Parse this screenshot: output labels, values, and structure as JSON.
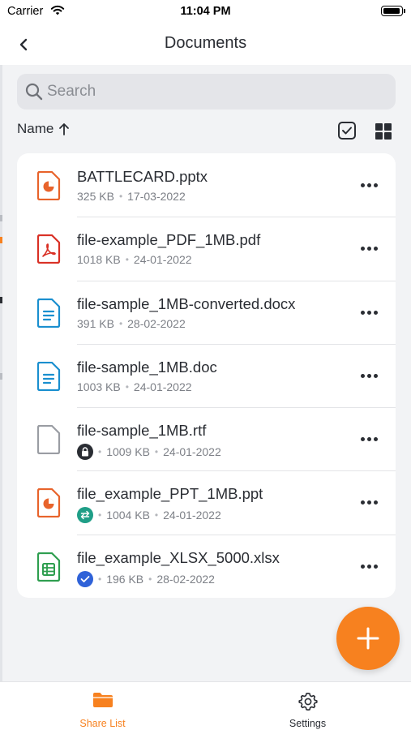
{
  "status_bar": {
    "carrier": "Carrier",
    "time": "11:04 PM"
  },
  "nav": {
    "title": "Documents"
  },
  "search": {
    "placeholder": "Search"
  },
  "sort": {
    "label": "Name",
    "direction": "ascending"
  },
  "files": [
    {
      "name": "BATTLECARD.pptx",
      "size": "325 KB",
      "date": "17-03-2022",
      "icon": "presentation-icon",
      "color": "#e8632b",
      "badge": null
    },
    {
      "name": "file-example_PDF_1MB.pdf",
      "size": "1018 KB",
      "date": "24-01-2022",
      "icon": "pdf-icon",
      "color": "#d93025",
      "badge": null
    },
    {
      "name": "file-sample_1MB-converted.docx",
      "size": "391 KB",
      "date": "28-02-2022",
      "icon": "document-icon",
      "color": "#1a8fcf",
      "badge": null
    },
    {
      "name": "file-sample_1MB.doc",
      "size": "1003 KB",
      "date": "24-01-2022",
      "icon": "document-icon",
      "color": "#1a8fcf",
      "badge": null
    },
    {
      "name": "file-sample_1MB.rtf",
      "size": "1009 KB",
      "date": "24-01-2022",
      "icon": "blank-file-icon",
      "color": "#9a9da3",
      "badge": "lock-icon"
    },
    {
      "name": "file_example_PPT_1MB.ppt",
      "size": "1004 KB",
      "date": "24-01-2022",
      "icon": "presentation-icon",
      "color": "#e8632b",
      "badge": "sync-icon"
    },
    {
      "name": "file_example_XLSX_5000.xlsx",
      "size": "196 KB",
      "date": "28-02-2022",
      "icon": "spreadsheet-icon",
      "color": "#2e9e4f",
      "badge": "check-icon"
    }
  ],
  "tabs": [
    {
      "label": "Share List",
      "icon": "folder-icon",
      "active": true
    },
    {
      "label": "Settings",
      "icon": "gear-icon",
      "active": false
    }
  ],
  "colors": {
    "accent": "#f7811f",
    "text": "#2a2d33",
    "muted": "#7d8087",
    "background": "#f2f3f5"
  }
}
